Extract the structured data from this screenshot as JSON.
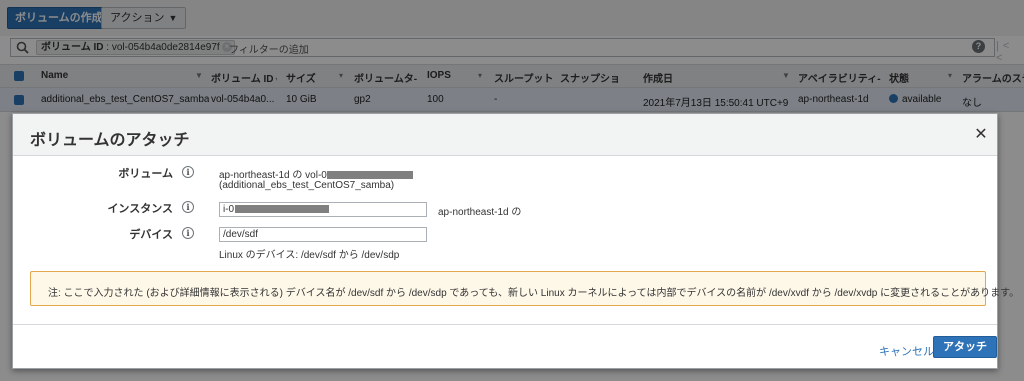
{
  "toolbar": {
    "create_volume_label": "ボリュームの作成",
    "actions_label": "アクション"
  },
  "filter": {
    "token_key": "ボリューム ID",
    "token_value": "vol-054b4a0de2814e97f",
    "placeholder": "フィルターの追加"
  },
  "table": {
    "headers": [
      "Name",
      "ボリューム ID",
      "サイズ",
      "ボリュームタ-",
      "IOPS",
      "スループット",
      "スナップショ",
      "作成日",
      "アベイラビリティ-",
      "状態",
      "アラームのステ"
    ],
    "row": {
      "name": "additional_ebs_test_CentOS7_samba",
      "volume_id": "vol-054b4a0...",
      "size": "10 GiB",
      "type": "gp2",
      "iops": "100",
      "throughput": "-",
      "snapshot": "",
      "created": "2021年7月13日 15:50:41 UTC+9",
      "az": "ap-northeast-1d",
      "state": "available",
      "alarm": "なし"
    }
  },
  "modal": {
    "title": "ボリュームのアタッチ",
    "volume_label": "ボリューム",
    "volume_line1": "ap-northeast-1d の vol-0",
    "volume_line2": "(additional_ebs_test_CentOS7_samba)",
    "instance_label": "インスタンス",
    "instance_value": "i-0",
    "instance_suffix": "ap-northeast-1d の",
    "device_label": "デバイス",
    "device_value": "/dev/sdf",
    "device_hint": "Linux のデバイス: /dev/sdf から /dev/sdp",
    "note": "注: ここで入力された (および詳細情報に表示される) デバイス名が /dev/sdf から /dev/sdp であっても、新しい Linux カーネルによっては内部でデバイスの名前が /dev/xvdf から /dev/xvdp に変更されることがあります。",
    "cancel_label": "キャンセル",
    "attach_label": "アタッチ"
  },
  "colors": {
    "primary": "#2e73b8",
    "note_border": "#e2a84b",
    "note_bg": "#fef8e9"
  }
}
